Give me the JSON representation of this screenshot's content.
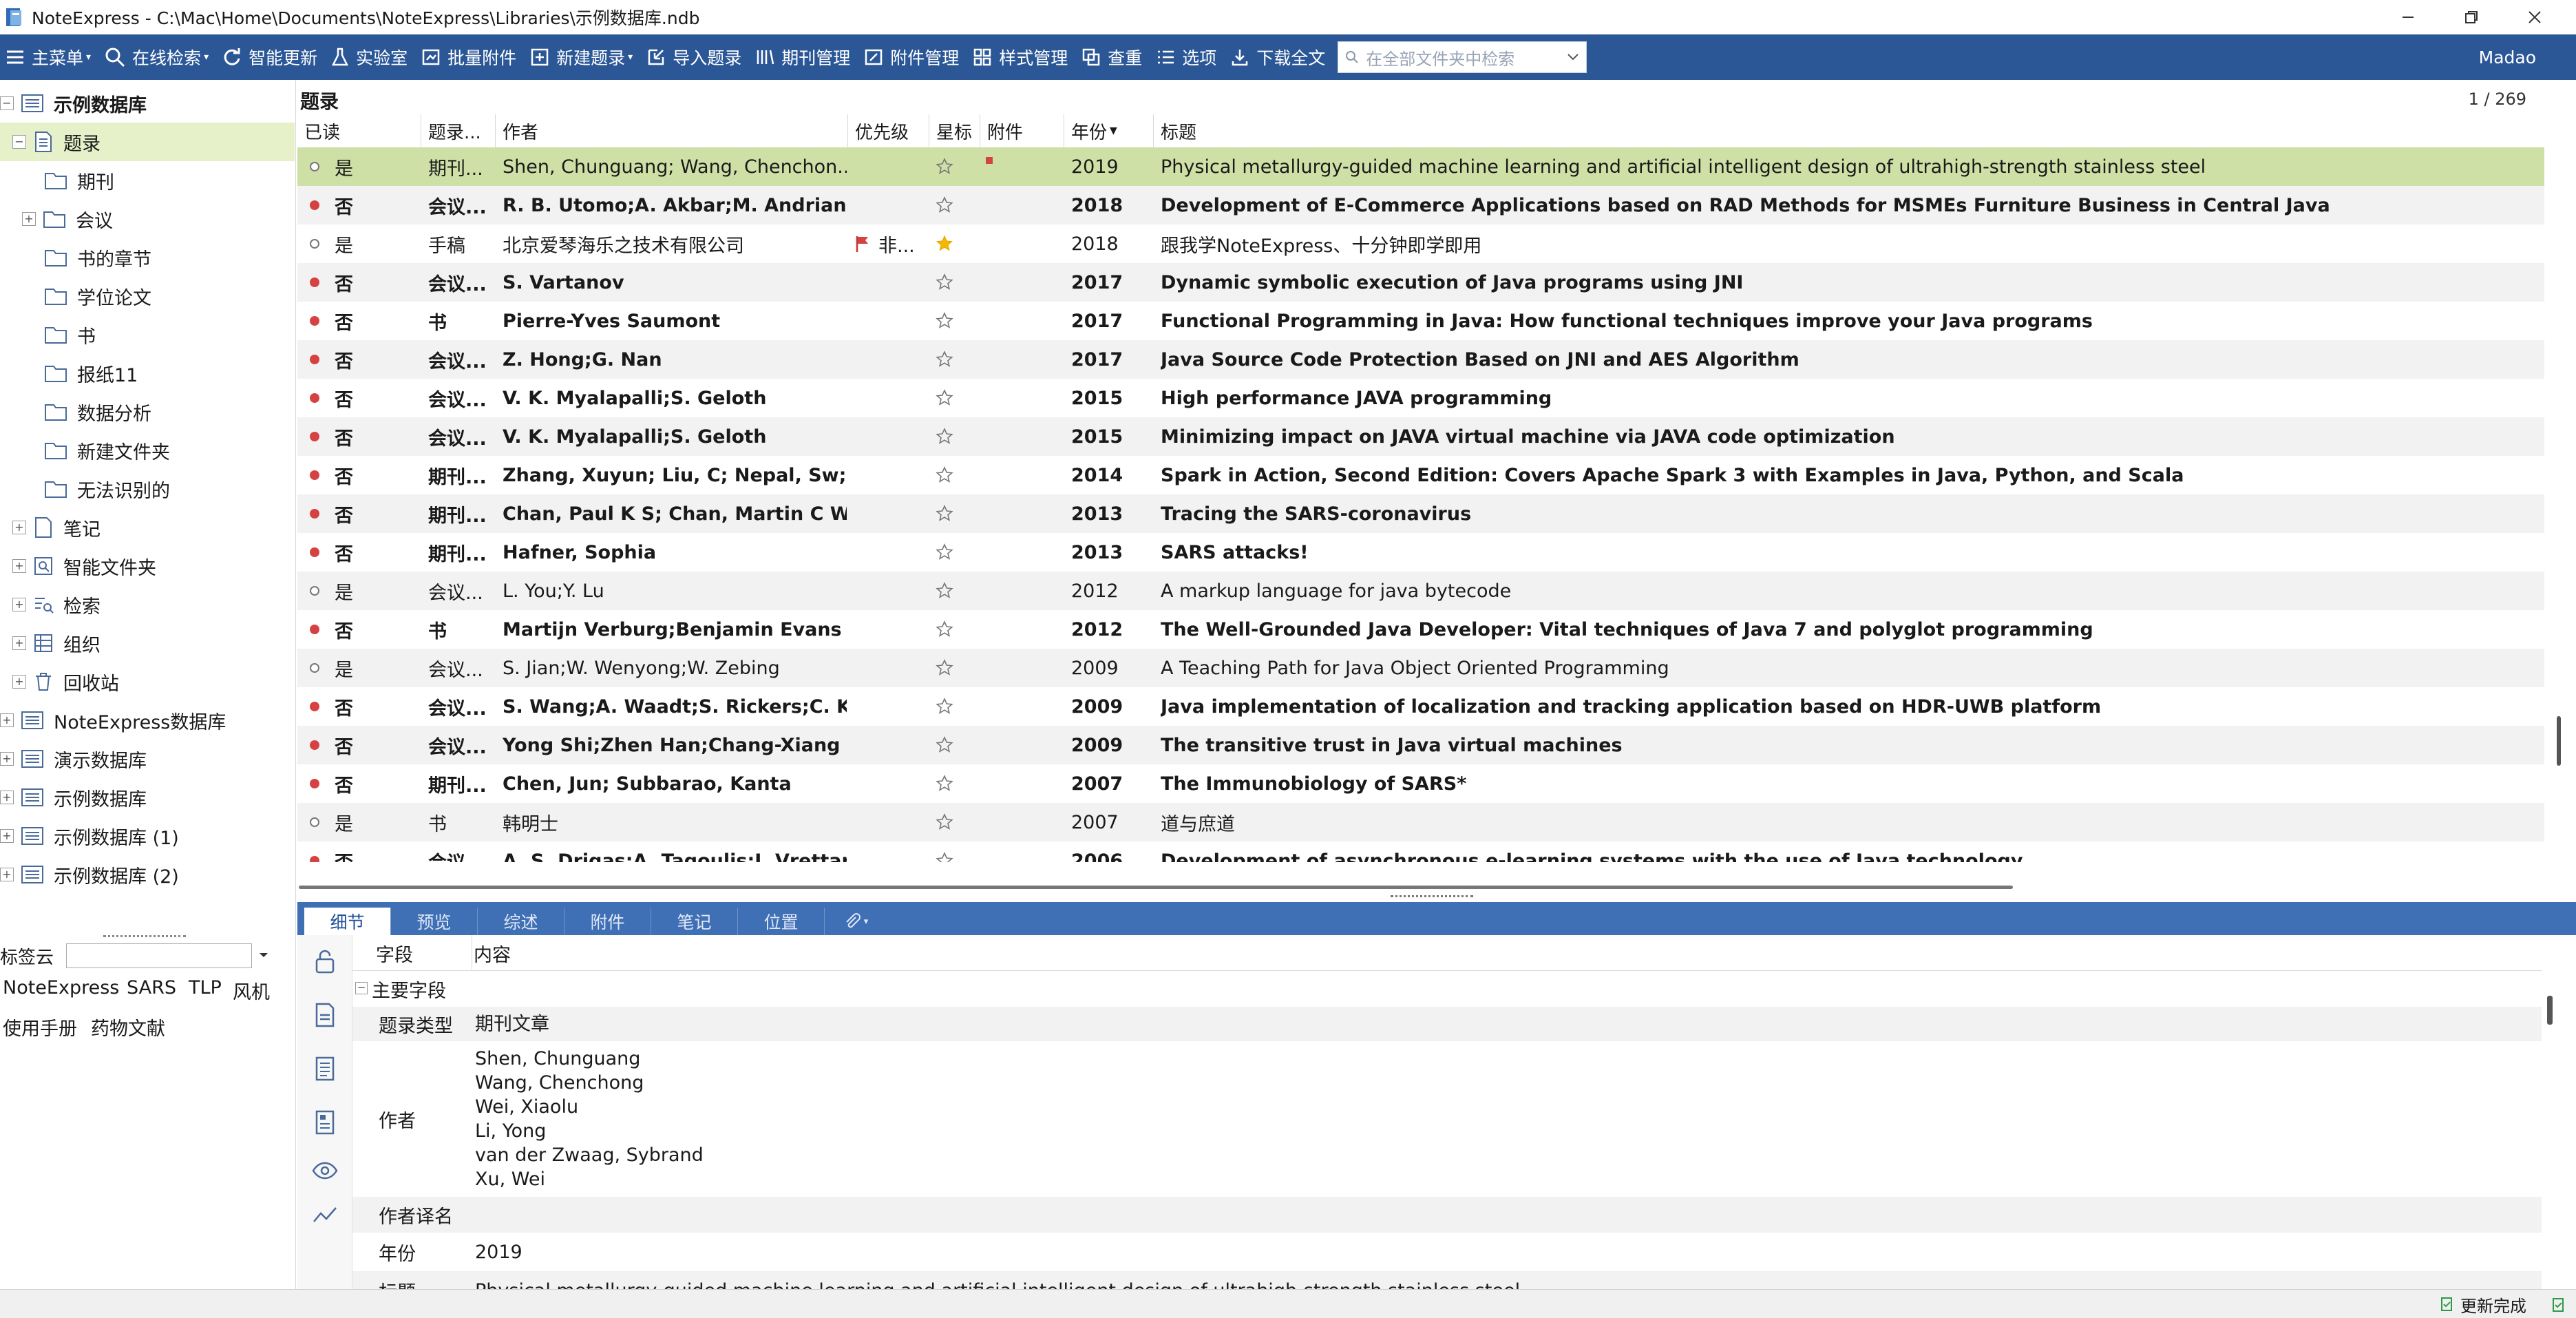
{
  "window": {
    "title": "NoteExpress - C:\\Mac\\Home\\Documents\\NoteExpress\\Libraries\\示例数据库.ndb"
  },
  "toolbar": {
    "main_menu": "主菜单",
    "online_search": "在线检索",
    "smart_update": "智能更新",
    "lab": "实验室",
    "batch_attach": "批量附件",
    "new_record": "新建题录",
    "import_records": "导入题录",
    "journal_mgmt": "期刊管理",
    "attachment_mgmt": "附件管理",
    "style_mgmt": "样式管理",
    "check_dup": "查重",
    "options": "选项",
    "download_fulltext": "下载全文",
    "search_placeholder": "在全部文件夹中检索",
    "user": "Madao"
  },
  "sidebar": {
    "root": "示例数据库",
    "records": "题录",
    "record_children": [
      "期刊",
      "会议",
      "书的章节",
      "学位论文",
      "书",
      "报纸11",
      "数据分析",
      "新建文件夹",
      "无法识别的"
    ],
    "notes": "笔记",
    "smart_folder": "智能文件夹",
    "search": "检索",
    "organize": "组织",
    "recycle": "回收站",
    "other_dbs": [
      "NoteExpress数据库",
      "演示数据库",
      "示例数据库",
      "示例数据库 (1)",
      "示例数据库 (2)"
    ]
  },
  "tag_cloud": {
    "label": "标签云",
    "tags": [
      "NoteExpress",
      "SARS",
      "TLP",
      "风机",
      "使用手册",
      "药物文献"
    ]
  },
  "list": {
    "title": "题录",
    "count": "1 / 269",
    "columns": {
      "read": "已读",
      "type": "题录...",
      "author": "作者",
      "priority": "优先级",
      "star": "星标",
      "attachment": "附件",
      "year": "年份",
      "title": "标题"
    },
    "rows": [
      {
        "read": "是",
        "type": "期刊...",
        "author": "Shen, Chunguang; Wang, Chenchon...",
        "priority": "",
        "year": "2019",
        "title": "Physical metallurgy-guided machine learning and artificial intelligent design of ultrahigh-strength stainless steel"
      },
      {
        "read": "否",
        "type": "会议...",
        "author": "R. B. Utomo;A. Akbar;M. Andriansya",
        "priority": "",
        "year": "2018",
        "title": "Development of E-Commerce Applications based on RAD Methods for MSMEs Furniture Business in Central Java"
      },
      {
        "read": "是",
        "type": "手稿",
        "author": "北京爱琴海乐之技术有限公司",
        "priority": "非...",
        "year": "2018",
        "title": "跟我学NoteExpress、十分钟即学即用"
      },
      {
        "read": "否",
        "type": "会议...",
        "author": "S. Vartanov",
        "priority": "",
        "year": "2017",
        "title": "Dynamic symbolic execution of Java programs using JNI"
      },
      {
        "read": "否",
        "type": "书",
        "author": "Pierre-Yves Saumont",
        "priority": "",
        "year": "2017",
        "title": "Functional Programming in Java: How functional techniques improve your Java programs"
      },
      {
        "read": "否",
        "type": "会议...",
        "author": "Z. Hong;G. Nan",
        "priority": "",
        "year": "2017",
        "title": "Java Source Code Protection Based on JNI and AES Algorithm"
      },
      {
        "read": "否",
        "type": "会议...",
        "author": "V. K. Myalapalli;S. Geloth",
        "priority": "",
        "year": "2015",
        "title": "High performance JAVA programming"
      },
      {
        "read": "否",
        "type": "会议...",
        "author": "V. K. Myalapalli;S. Geloth",
        "priority": "",
        "year": "2015",
        "title": "Minimizing impact on JAVA virtual machine via JAVA code optimization"
      },
      {
        "read": "否",
        "type": "期刊...",
        "author": "Zhang, Xuyun; Liu, C; Nepal, Sw; Yar",
        "priority": "",
        "year": "2014",
        "title": "Spark in Action, Second Edition: Covers Apache Spark 3 with Examples in Java, Python, and Scala"
      },
      {
        "read": "否",
        "type": "期刊...",
        "author": "Chan, Paul K S; Chan, Martin C W",
        "priority": "",
        "year": "2013",
        "title": "Tracing the SARS-coronavirus"
      },
      {
        "read": "否",
        "type": "期刊...",
        "author": "Hafner, Sophia",
        "priority": "",
        "year": "2013",
        "title": "SARS attacks!"
      },
      {
        "read": "是",
        "type": "会议...",
        "author": "L. You;Y. Lu",
        "priority": "",
        "year": "2012",
        "title": "A markup language for java bytecode"
      },
      {
        "read": "否",
        "type": "书",
        "author": "Martijn Verburg;Benjamin Evans",
        "priority": "",
        "year": "2012",
        "title": "The Well-Grounded Java Developer: Vital techniques of Java 7 and polyglot programming"
      },
      {
        "read": "是",
        "type": "会议...",
        "author": "S. Jian;W. Wenyong;W. Zebing",
        "priority": "",
        "year": "2009",
        "title": "A Teaching Path for Java Object Oriented Programming"
      },
      {
        "read": "否",
        "type": "会议...",
        "author": "S. Wang;A. Waadt;S. Rickers;C. Kock.",
        "priority": "",
        "year": "2009",
        "title": "Java implementation of localization and tracking application based on HDR-UWB platform"
      },
      {
        "read": "否",
        "type": "会议...",
        "author": "Yong Shi;Zhen Han;Chang-Xiang Sh.",
        "priority": "",
        "year": "2009",
        "title": "The transitive trust in Java virtual machines"
      },
      {
        "read": "否",
        "type": "期刊...",
        "author": "Chen, Jun; Subbarao, Kanta",
        "priority": "",
        "year": "2007",
        "title": "The Immunobiology of SARS*"
      },
      {
        "read": "是",
        "type": "书",
        "author": "韩明士",
        "priority": "",
        "year": "2007",
        "title": "道与庶道"
      },
      {
        "read": "否",
        "type": "会议...",
        "author": "A. S. Drigas;A. Tagoulis;I. Vrettaros",
        "priority": "",
        "year": "2006",
        "title": "Development of asynchronous e-learning systems with the use of Java technology"
      }
    ]
  },
  "detail": {
    "tabs": [
      "细节",
      "预览",
      "综述",
      "附件",
      "笔记",
      "位置"
    ],
    "head_field": "字段",
    "head_content": "内容",
    "group": "主要字段",
    "fields": {
      "type_label": "题录类型",
      "type_value": "期刊文章",
      "author_label": "作者",
      "authors": [
        "Shen, Chunguang",
        "Wang, Chenchong",
        "Wei, Xiaolu",
        "Li, Yong",
        "van der Zwaag, Sybrand",
        "Xu, Wei"
      ],
      "author_trans_label": "作者译名",
      "year_label": "年份",
      "year_value": "2019",
      "title_label": "标题",
      "title_value": "Physical metallurgy-guided machine learning and artificial intelligent design of ultrahigh-strength stainless steel"
    }
  },
  "status": {
    "text": "更新完成"
  },
  "colors": {
    "toolbar": "#2b5797",
    "selected_row": "#cfe0a6",
    "unread_dot": "#d64242",
    "star_filled": "#f5b800"
  }
}
